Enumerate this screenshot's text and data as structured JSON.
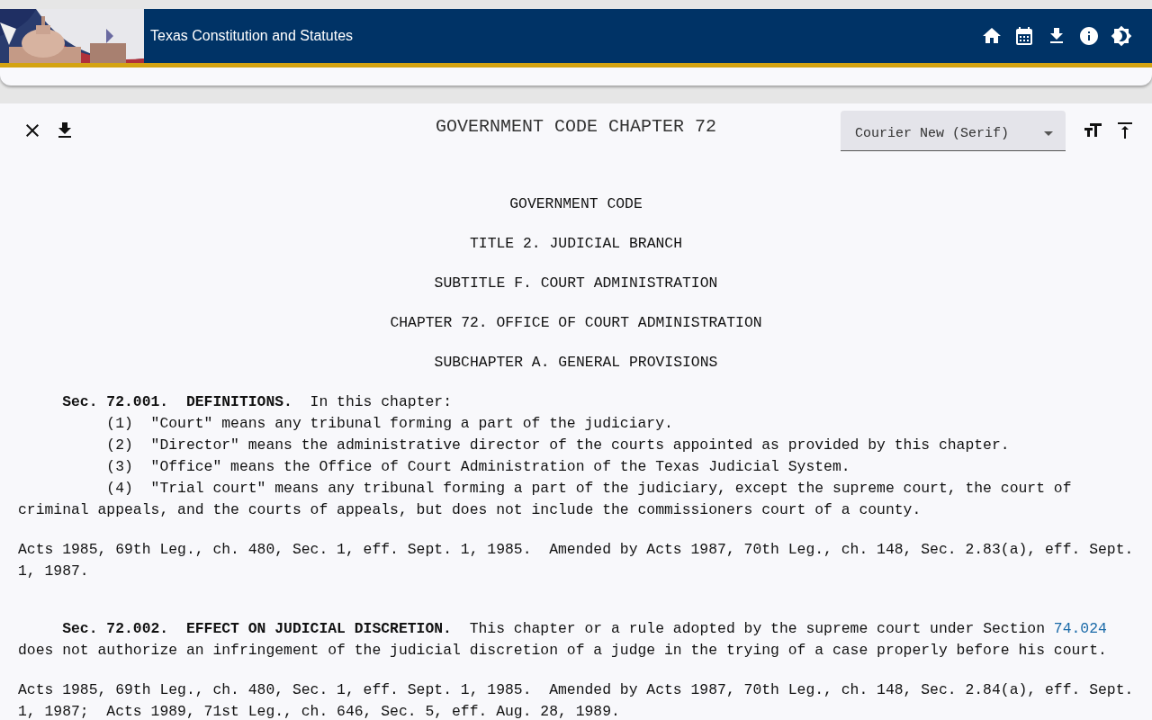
{
  "header": {
    "title": "Texas Constitution and Statutes"
  },
  "document": {
    "title": "GOVERNMENT CODE CHAPTER 72",
    "font_select": {
      "value": "Courier New (Serif)"
    },
    "headings": [
      "GOVERNMENT CODE",
      "TITLE 2. JUDICIAL BRANCH",
      "SUBTITLE F. COURT ADMINISTRATION",
      "CHAPTER 72. OFFICE OF COURT ADMINISTRATION",
      "SUBCHAPTER A. GENERAL PROVISIONS"
    ],
    "sections": [
      {
        "body": [
          {
            "kind": "text",
            "text": "**Sec. 72.001.  DEFINITIONS.**  In this chapter:"
          }
        ],
        "items": [
          "(1)  \"Court\" means any tribunal forming a part of the judiciary.",
          "(2)  \"Director\" means the administrative director of the courts appointed as provided by this chapter.",
          "(3)  \"Office\" means the Office of Court Administration of the Texas Judicial System.",
          "(4)  \"Trial court\" means any tribunal forming a part of the judiciary, except the supreme court, the court of criminal appeals, and the courts of appeals, but does not include the commissioners court of a county."
        ],
        "history": "Acts 1985, 69th Leg., ch. 480, Sec. 1, eff. Sept. 1, 1985.  Amended by Acts 1987, 70th Leg., ch. 148, Sec. 2.83(a), eff. Sept. 1, 1987."
      },
      {
        "body": [
          {
            "kind": "text",
            "text": "**Sec. 72.002.  EFFECT ON JUDICIAL DISCRETION.**  This chapter or a rule adopted by the supreme court under Section "
          },
          {
            "kind": "link",
            "text": "74.024"
          },
          {
            "kind": "text",
            "text": " does not authorize an infringement of the judicial discretion of a judge in the trying of a case properly before his court."
          }
        ],
        "history": "Acts 1985, 69th Leg., ch. 480, Sec. 1, eff. Sept. 1, 1985.  Amended by Acts 1987, 70th Leg., ch. 148, Sec. 2.84(a), eff. Sept. 1, 1987;  Acts 1989, 71st Leg., ch. 646, Sec. 5, eff. Aug. 28, 1989."
      }
    ]
  }
}
